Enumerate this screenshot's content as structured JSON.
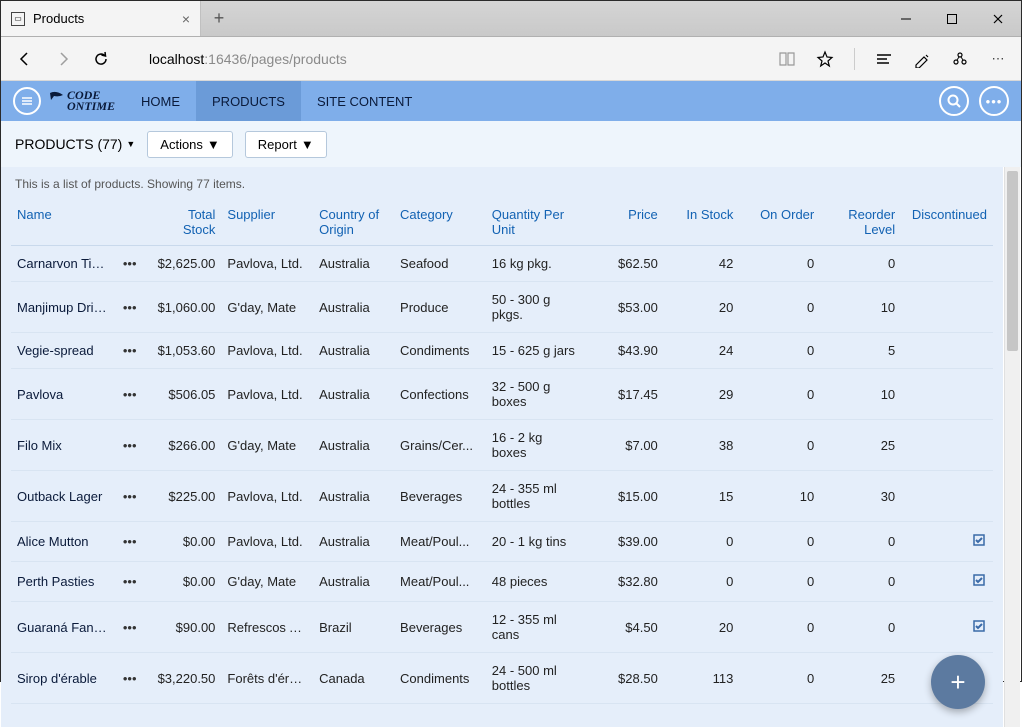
{
  "browser": {
    "tab_title": "Products",
    "url_host": "localhost",
    "url_path": ":16436/pages/products"
  },
  "app": {
    "logo_top": "CODE",
    "logo_bottom": "ONTIME",
    "nav": {
      "home": "HOME",
      "products": "PRODUCTS",
      "site_content": "SITE CONTENT"
    }
  },
  "toolbar": {
    "heading": "PRODUCTS (77)",
    "actions": "Actions",
    "report": "Report"
  },
  "grid": {
    "caption": "This is a list of products. Showing 77 items.",
    "columns": {
      "name": "Name",
      "total_stock": "Total Stock",
      "supplier": "Supplier",
      "country": "Country of Origin",
      "category": "Category",
      "qpu": "Quantity Per Unit",
      "price": "Price",
      "in_stock": "In Stock",
      "on_order": "On Order",
      "reorder": "Reorder Level",
      "discontinued": "Discontinued"
    },
    "rows": [
      {
        "name": "Carnarvon Tigers",
        "total": "$2,625.00",
        "supplier": "Pavlova, Ltd.",
        "country": "Australia",
        "category": "Seafood",
        "qpu": "16 kg pkg.",
        "price": "$62.50",
        "in_stock": "42",
        "on_order": "0",
        "reorder": "0",
        "disc": false
      },
      {
        "name": "Manjimup Dried Apples",
        "total": "$1,060.00",
        "supplier": "G'day, Mate",
        "country": "Australia",
        "category": "Produce",
        "qpu": "50 - 300 g pkgs.",
        "price": "$53.00",
        "in_stock": "20",
        "on_order": "0",
        "reorder": "10",
        "disc": false
      },
      {
        "name": "Vegie-spread",
        "total": "$1,053.60",
        "supplier": "Pavlova, Ltd.",
        "country": "Australia",
        "category": "Condiments",
        "qpu": "15 - 625 g jars",
        "price": "$43.90",
        "in_stock": "24",
        "on_order": "0",
        "reorder": "5",
        "disc": false
      },
      {
        "name": "Pavlova",
        "total": "$506.05",
        "supplier": "Pavlova, Ltd.",
        "country": "Australia",
        "category": "Confections",
        "qpu": "32 - 500 g boxes",
        "price": "$17.45",
        "in_stock": "29",
        "on_order": "0",
        "reorder": "10",
        "disc": false
      },
      {
        "name": "Filo Mix",
        "total": "$266.00",
        "supplier": "G'day, Mate",
        "country": "Australia",
        "category": "Grains/Cer...",
        "qpu": "16 - 2 kg boxes",
        "price": "$7.00",
        "in_stock": "38",
        "on_order": "0",
        "reorder": "25",
        "disc": false
      },
      {
        "name": "Outback Lager",
        "total": "$225.00",
        "supplier": "Pavlova, Ltd.",
        "country": "Australia",
        "category": "Beverages",
        "qpu": "24 - 355 ml bottles",
        "price": "$15.00",
        "in_stock": "15",
        "on_order": "10",
        "reorder": "30",
        "disc": false
      },
      {
        "name": "Alice Mutton",
        "total": "$0.00",
        "supplier": "Pavlova, Ltd.",
        "country": "Australia",
        "category": "Meat/Poul...",
        "qpu": "20 - 1 kg tins",
        "price": "$39.00",
        "in_stock": "0",
        "on_order": "0",
        "reorder": "0",
        "disc": true
      },
      {
        "name": "Perth Pasties",
        "total": "$0.00",
        "supplier": "G'day, Mate",
        "country": "Australia",
        "category": "Meat/Poul...",
        "qpu": "48 pieces",
        "price": "$32.80",
        "in_stock": "0",
        "on_order": "0",
        "reorder": "0",
        "disc": true
      },
      {
        "name": "Guaraná Fantástica",
        "total": "$90.00",
        "supplier": "Refrescos Americanas LTDA",
        "country": "Brazil",
        "category": "Beverages",
        "qpu": "12 - 355 ml cans",
        "price": "$4.50",
        "in_stock": "20",
        "on_order": "0",
        "reorder": "0",
        "disc": true
      },
      {
        "name": "Sirop d'érable",
        "total": "$3,220.50",
        "supplier": "Forêts d'érables",
        "country": "Canada",
        "category": "Condiments",
        "qpu": "24 - 500 ml bottles",
        "price": "$28.50",
        "in_stock": "113",
        "on_order": "0",
        "reorder": "25",
        "disc": false
      }
    ]
  }
}
